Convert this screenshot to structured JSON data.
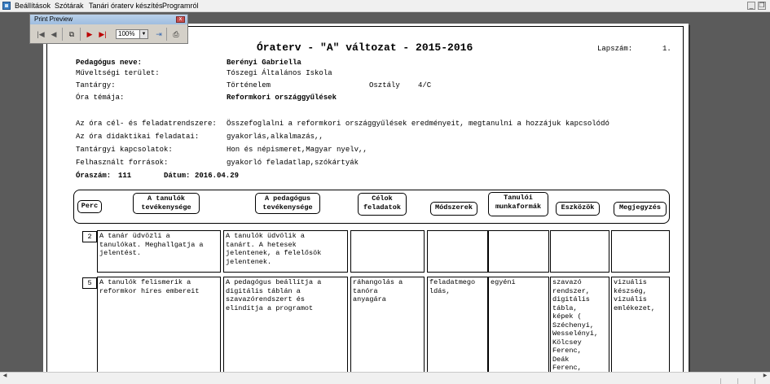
{
  "menu": {
    "items": [
      "Beállítások",
      "Szótárak",
      "Tanári óraterv készítés",
      "Programról"
    ],
    "min_btn": "_",
    "restore_btn": "❐"
  },
  "toolbar": {
    "title": "Print Preview",
    "close": "x",
    "zoom": "100%",
    "buttons": [
      "first-page-icon",
      "prev-page-icon",
      "pages-icon",
      "next-page-icon",
      "last-page-icon",
      "zoom-select",
      "exit-icon",
      "print-icon"
    ]
  },
  "doc": {
    "title": "Óraterv - \"A\" változat - 2015-2016",
    "page_label": "Lapszám:",
    "page_number": "1.",
    "fields": [
      {
        "label": "Pedagógus neve:",
        "value": "Berényi Gabriella"
      },
      {
        "label": "Műveltségi terület:",
        "value": "Tószegi Általános Iskola"
      },
      {
        "label": "Tantárgy:",
        "value": "Történelem"
      },
      {
        "label": "Óra témája:",
        "value": "Reformkori országgyűlések"
      }
    ],
    "class_label": "Osztály",
    "class_value": "4/C",
    "goals": [
      {
        "label": "Az óra cél- és feladatrendszere:",
        "value": "Összefoglalni a reformkori országgyűlések eredményeit, megtanulni a hozzájuk kapcsolódó"
      },
      {
        "label": "Az óra didaktikai feladatai:",
        "value": "gyakorlás,alkalmazás,,"
      },
      {
        "label": "Tantárgyi kapcsolatok:",
        "value": "Hon és népismeret,Magyar nyelv,,"
      },
      {
        "label": "Felhasznált források:",
        "value": "gyakorló feladatlap,szókártyák"
      }
    ],
    "hours_label": "Óraszám:",
    "hours_value": "111",
    "date_label": "Dátum:",
    "date_value": "2016.04.29"
  },
  "table": {
    "headers": [
      "Perc",
      "A tanulók\ntevékenysége",
      "A pedagógus\ntevékenysége",
      "Célok\nfeladatok",
      "Módszerek",
      "Tanulói\nmunkaformák",
      "Eszközök",
      "Megjegyzés"
    ],
    "rows": [
      {
        "minutes": "2",
        "cells": [
          "A tanár üdvözli a\ntanulókat. Meghallgatja a\njelentést.",
          "A tanulók üdvölik a\ntanárt. A hetesek\njelentenek, a felelősök\njelentenek.",
          "",
          "",
          "",
          "",
          ""
        ]
      },
      {
        "minutes": "5",
        "cells": [
          "A tanulók felismerik a\nreformkor híres embereit",
          "A pedagógus beállítja a\ndigitális táblán a\nszavazórendszert és\nelindítja a programot",
          "ráhangolás a\ntanóra\nanyagára",
          "feladatmego\nldás,",
          "egyéni",
          "szavazó\nrendszer,\ndigitális\ntábla,\nképek (\nSzéchenyi,\nWesselényi,\nKölcsey\nFerenc,\nDeák\nFerenc,",
          "vizuális\nkészség,\nvizuális\nemlékezet,"
        ]
      }
    ]
  }
}
